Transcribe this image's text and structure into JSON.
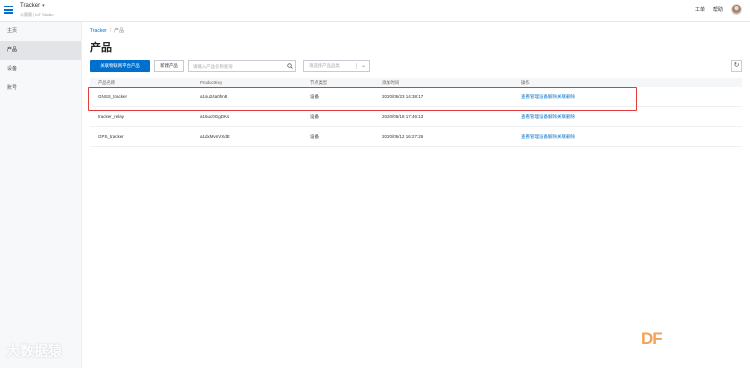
{
  "header": {
    "title": "Tracker",
    "subtitle": "公版版 | IoT Studio",
    "right_links": [
      "工单",
      "帮助"
    ]
  },
  "sidebar": {
    "items": [
      {
        "label": "主页",
        "active": false
      },
      {
        "label": "产品",
        "active": true
      },
      {
        "label": "设备",
        "active": false
      },
      {
        "label": "账号",
        "active": false
      }
    ]
  },
  "breadcrumb": {
    "root": "Tracker",
    "sep": "/",
    "current": "产品"
  },
  "page": {
    "title": "产品"
  },
  "toolbar": {
    "import_label": "关联物联网平台产品",
    "create_label": "新建产品",
    "search_placeholder": "请输入产品名称查询",
    "filter_placeholder": "请选择产品品类"
  },
  "table": {
    "columns": [
      "产品名称",
      "ProductKey",
      "节点类型",
      "添加时间",
      "操作"
    ],
    "rows": [
      {
        "name": "GNSS_tracker",
        "key": "a1su24a0hn8",
        "node": "设备",
        "added": "2020/05/23 14:38:17"
      },
      {
        "name": "tracker_relay",
        "key": "a16uc0GgDKs",
        "node": "设备",
        "added": "2020/05/18 17:46:13"
      },
      {
        "name": "GPS_tracker",
        "key": "a1dxMvnVXdE",
        "node": "设备",
        "added": "2020/05/12 16:27:25"
      }
    ],
    "actions": [
      "查看",
      "管理设备",
      "解除关联",
      "删除"
    ]
  },
  "colors": {
    "primary": "#0070cc",
    "highlight": "#e23b3b"
  },
  "watermark": {
    "brand": "DF",
    "text": "大数据猿"
  }
}
